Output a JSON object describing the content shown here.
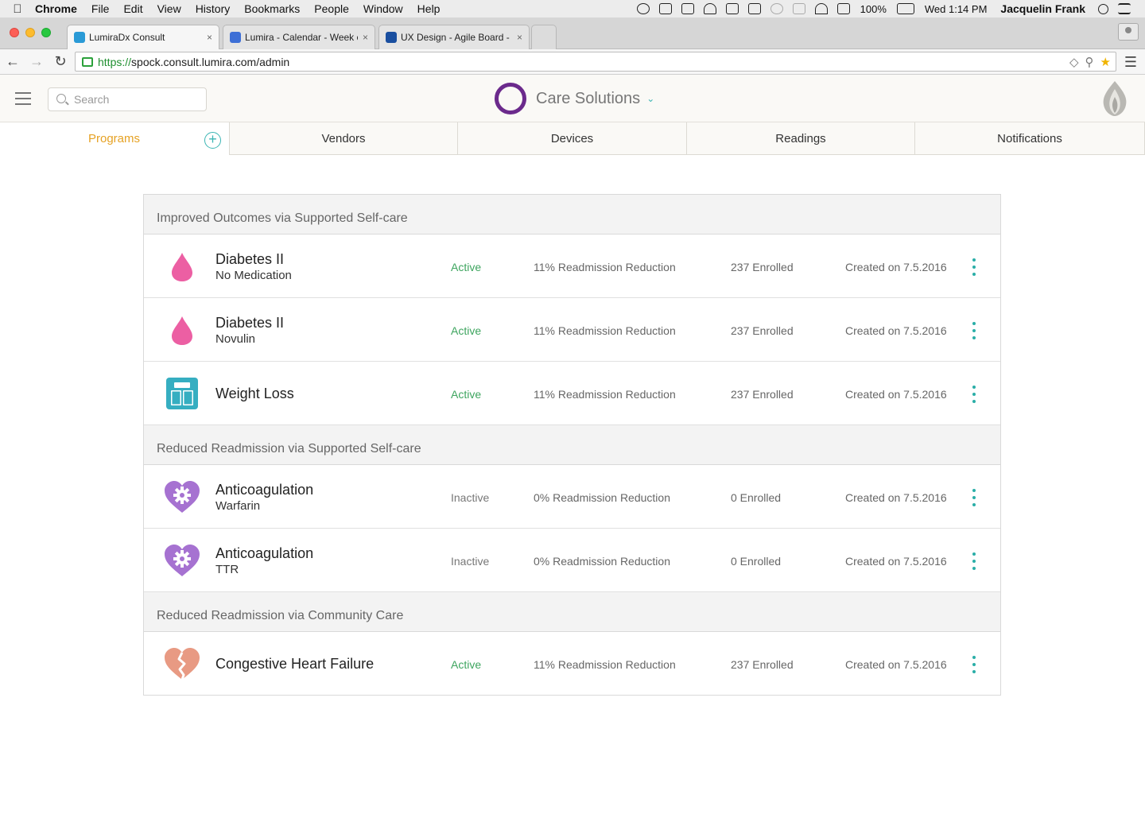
{
  "menubar": {
    "app": "Chrome",
    "items": [
      "File",
      "Edit",
      "View",
      "History",
      "Bookmarks",
      "People",
      "Window",
      "Help"
    ],
    "battery": "100%",
    "clock": "Wed 1:14 PM",
    "user": "Jacquelin Frank"
  },
  "browser": {
    "tabs": [
      {
        "title": "LumiraDx Consult",
        "favicon_color": "#2a9ad6"
      },
      {
        "title": "Lumira - Calendar - Week c",
        "favicon_color": "#3d6fd6"
      },
      {
        "title": "UX Design - Agile Board - L",
        "favicon_color": "#1a4fa0"
      }
    ],
    "tab_close": "×",
    "url_scheme": "https://",
    "url_rest": "spock.consult.lumira.com/admin"
  },
  "header": {
    "search_placeholder": "Search",
    "brand": "Care Solutions"
  },
  "nav": {
    "tabs": [
      "Programs",
      "Vendors",
      "Devices",
      "Readings",
      "Notifications"
    ],
    "add_symbol": "+"
  },
  "colors": {
    "accent_teal": "#3bb5b4",
    "active_tab": "#e6a224",
    "status_active": "#3ea55f",
    "brand_purple": "#6b2a8c",
    "drop_pink": "#ec5fa3",
    "scale_teal": "#36aec1",
    "heart_purple": "#a672d1",
    "heart_coral": "#e89a83"
  },
  "groups": [
    {
      "title": "Improved Outcomes via Supported Self-care",
      "programs": [
        {
          "icon": "drop-icon",
          "name": "Diabetes II",
          "sub": "No Medication",
          "status": "Active",
          "reduction": "11% Readmission Reduction",
          "enrolled": "237 Enrolled",
          "created": "Created on 7.5.2016"
        },
        {
          "icon": "drop-icon",
          "name": "Diabetes II",
          "sub": "Novulin",
          "status": "Active",
          "reduction": "11% Readmission Reduction",
          "enrolled": "237 Enrolled",
          "created": "Created on 7.5.2016"
        },
        {
          "icon": "scale-icon",
          "name": "Weight Loss",
          "sub": "",
          "status": "Active",
          "reduction": "11% Readmission Reduction",
          "enrolled": "237 Enrolled",
          "created": "Created on 7.5.2016"
        }
      ]
    },
    {
      "title": "Reduced Readmission via Supported Self-care",
      "programs": [
        {
          "icon": "heart-gear-icon",
          "name": "Anticoagulation",
          "sub": "Warfarin",
          "status": "Inactive",
          "reduction": "0% Readmission Reduction",
          "enrolled": "0 Enrolled",
          "created": "Created on 7.5.2016"
        },
        {
          "icon": "heart-gear-icon",
          "name": "Anticoagulation",
          "sub": "TTR",
          "status": "Inactive",
          "reduction": "0% Readmission Reduction",
          "enrolled": "0 Enrolled",
          "created": "Created on 7.5.2016"
        }
      ]
    },
    {
      "title": "Reduced Readmission via Community Care",
      "programs": [
        {
          "icon": "broken-heart-icon",
          "name": "Congestive Heart Failure",
          "sub": "",
          "status": "Active",
          "reduction": "11% Readmission Reduction",
          "enrolled": "237 Enrolled",
          "created": "Created on 7.5.2016"
        }
      ]
    }
  ]
}
